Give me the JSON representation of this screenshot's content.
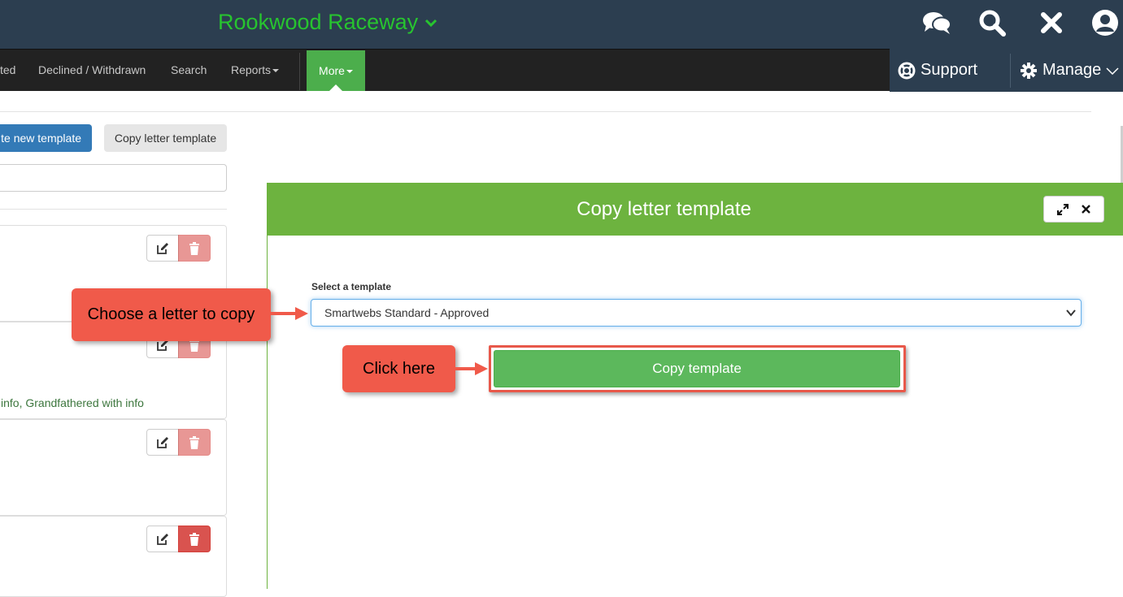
{
  "header": {
    "venue_name": "Rookwood Raceway",
    "icons": [
      "chat-icon",
      "search-icon",
      "close-icon",
      "user-icon"
    ]
  },
  "navbar": {
    "items": [
      {
        "label": "ted"
      },
      {
        "label": "Declined / Withdrawn"
      },
      {
        "label": "Search"
      },
      {
        "label": "Reports"
      }
    ],
    "more_label": "More",
    "support_label": "Support",
    "manage_label": "Manage"
  },
  "toolbar": {
    "create_label": "te new template",
    "copy_label": "Copy letter template"
  },
  "list": {
    "card2_text": "info, Grandfathered with info"
  },
  "modal": {
    "title": "Copy letter template",
    "field_label": "Select a template",
    "selected_template": "Smartwebs Standard - Approved",
    "copy_button_label": "Copy template"
  },
  "callouts": {
    "choose": "Choose a letter to copy",
    "click": "Click here"
  },
  "colors": {
    "header_bg": "#2c3e50",
    "venue_text": "#27c42f",
    "navbar_bg": "#222222",
    "more_bg": "#4cae4c",
    "modal_header": "#6db33f",
    "primary": "#337ab7",
    "success": "#5cb85c",
    "danger": "#d9534f",
    "callout": "#f05a4a"
  }
}
